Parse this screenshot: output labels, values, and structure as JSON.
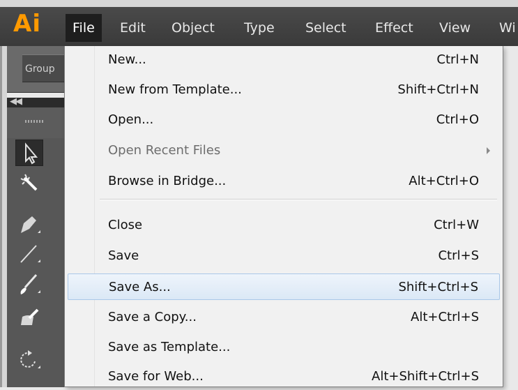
{
  "app": {
    "logo": "Ai",
    "accent_color": "#ff9a00"
  },
  "menubar": {
    "items": [
      {
        "label": "File",
        "active": true
      },
      {
        "label": "Edit"
      },
      {
        "label": "Object"
      },
      {
        "label": "Type"
      },
      {
        "label": "Select"
      },
      {
        "label": "Effect"
      },
      {
        "label": "View"
      },
      {
        "label": "Wi"
      }
    ]
  },
  "controlbar": {
    "selection_label": "Group"
  },
  "toolbar": {
    "tools": [
      "selection-icon",
      "magic-wand-icon",
      "pen-icon",
      "line-segment-icon",
      "paintbrush-icon",
      "blob-brush-icon",
      "rotate-icon"
    ]
  },
  "file_menu": {
    "items": [
      {
        "label": "New...",
        "shortcut": "Ctrl+N"
      },
      {
        "label": "New from Template...",
        "shortcut": "Shift+Ctrl+N"
      },
      {
        "label": "Open...",
        "shortcut": "Ctrl+O"
      },
      {
        "label": "Open Recent Files",
        "shortcut": "",
        "disabled": true,
        "submenu": true
      },
      {
        "label": "Browse in Bridge...",
        "shortcut": "Alt+Ctrl+O"
      },
      {
        "label": "Close",
        "shortcut": "Ctrl+W"
      },
      {
        "label": "Save",
        "shortcut": "Ctrl+S"
      },
      {
        "label": "Save As...",
        "shortcut": "Shift+Ctrl+S",
        "highlighted": true
      },
      {
        "label": "Save a Copy...",
        "shortcut": "Alt+Ctrl+S"
      },
      {
        "label": "Save as Template...",
        "shortcut": ""
      },
      {
        "label": "Save for Web...",
        "shortcut": "Alt+Shift+Ctrl+S"
      }
    ]
  }
}
